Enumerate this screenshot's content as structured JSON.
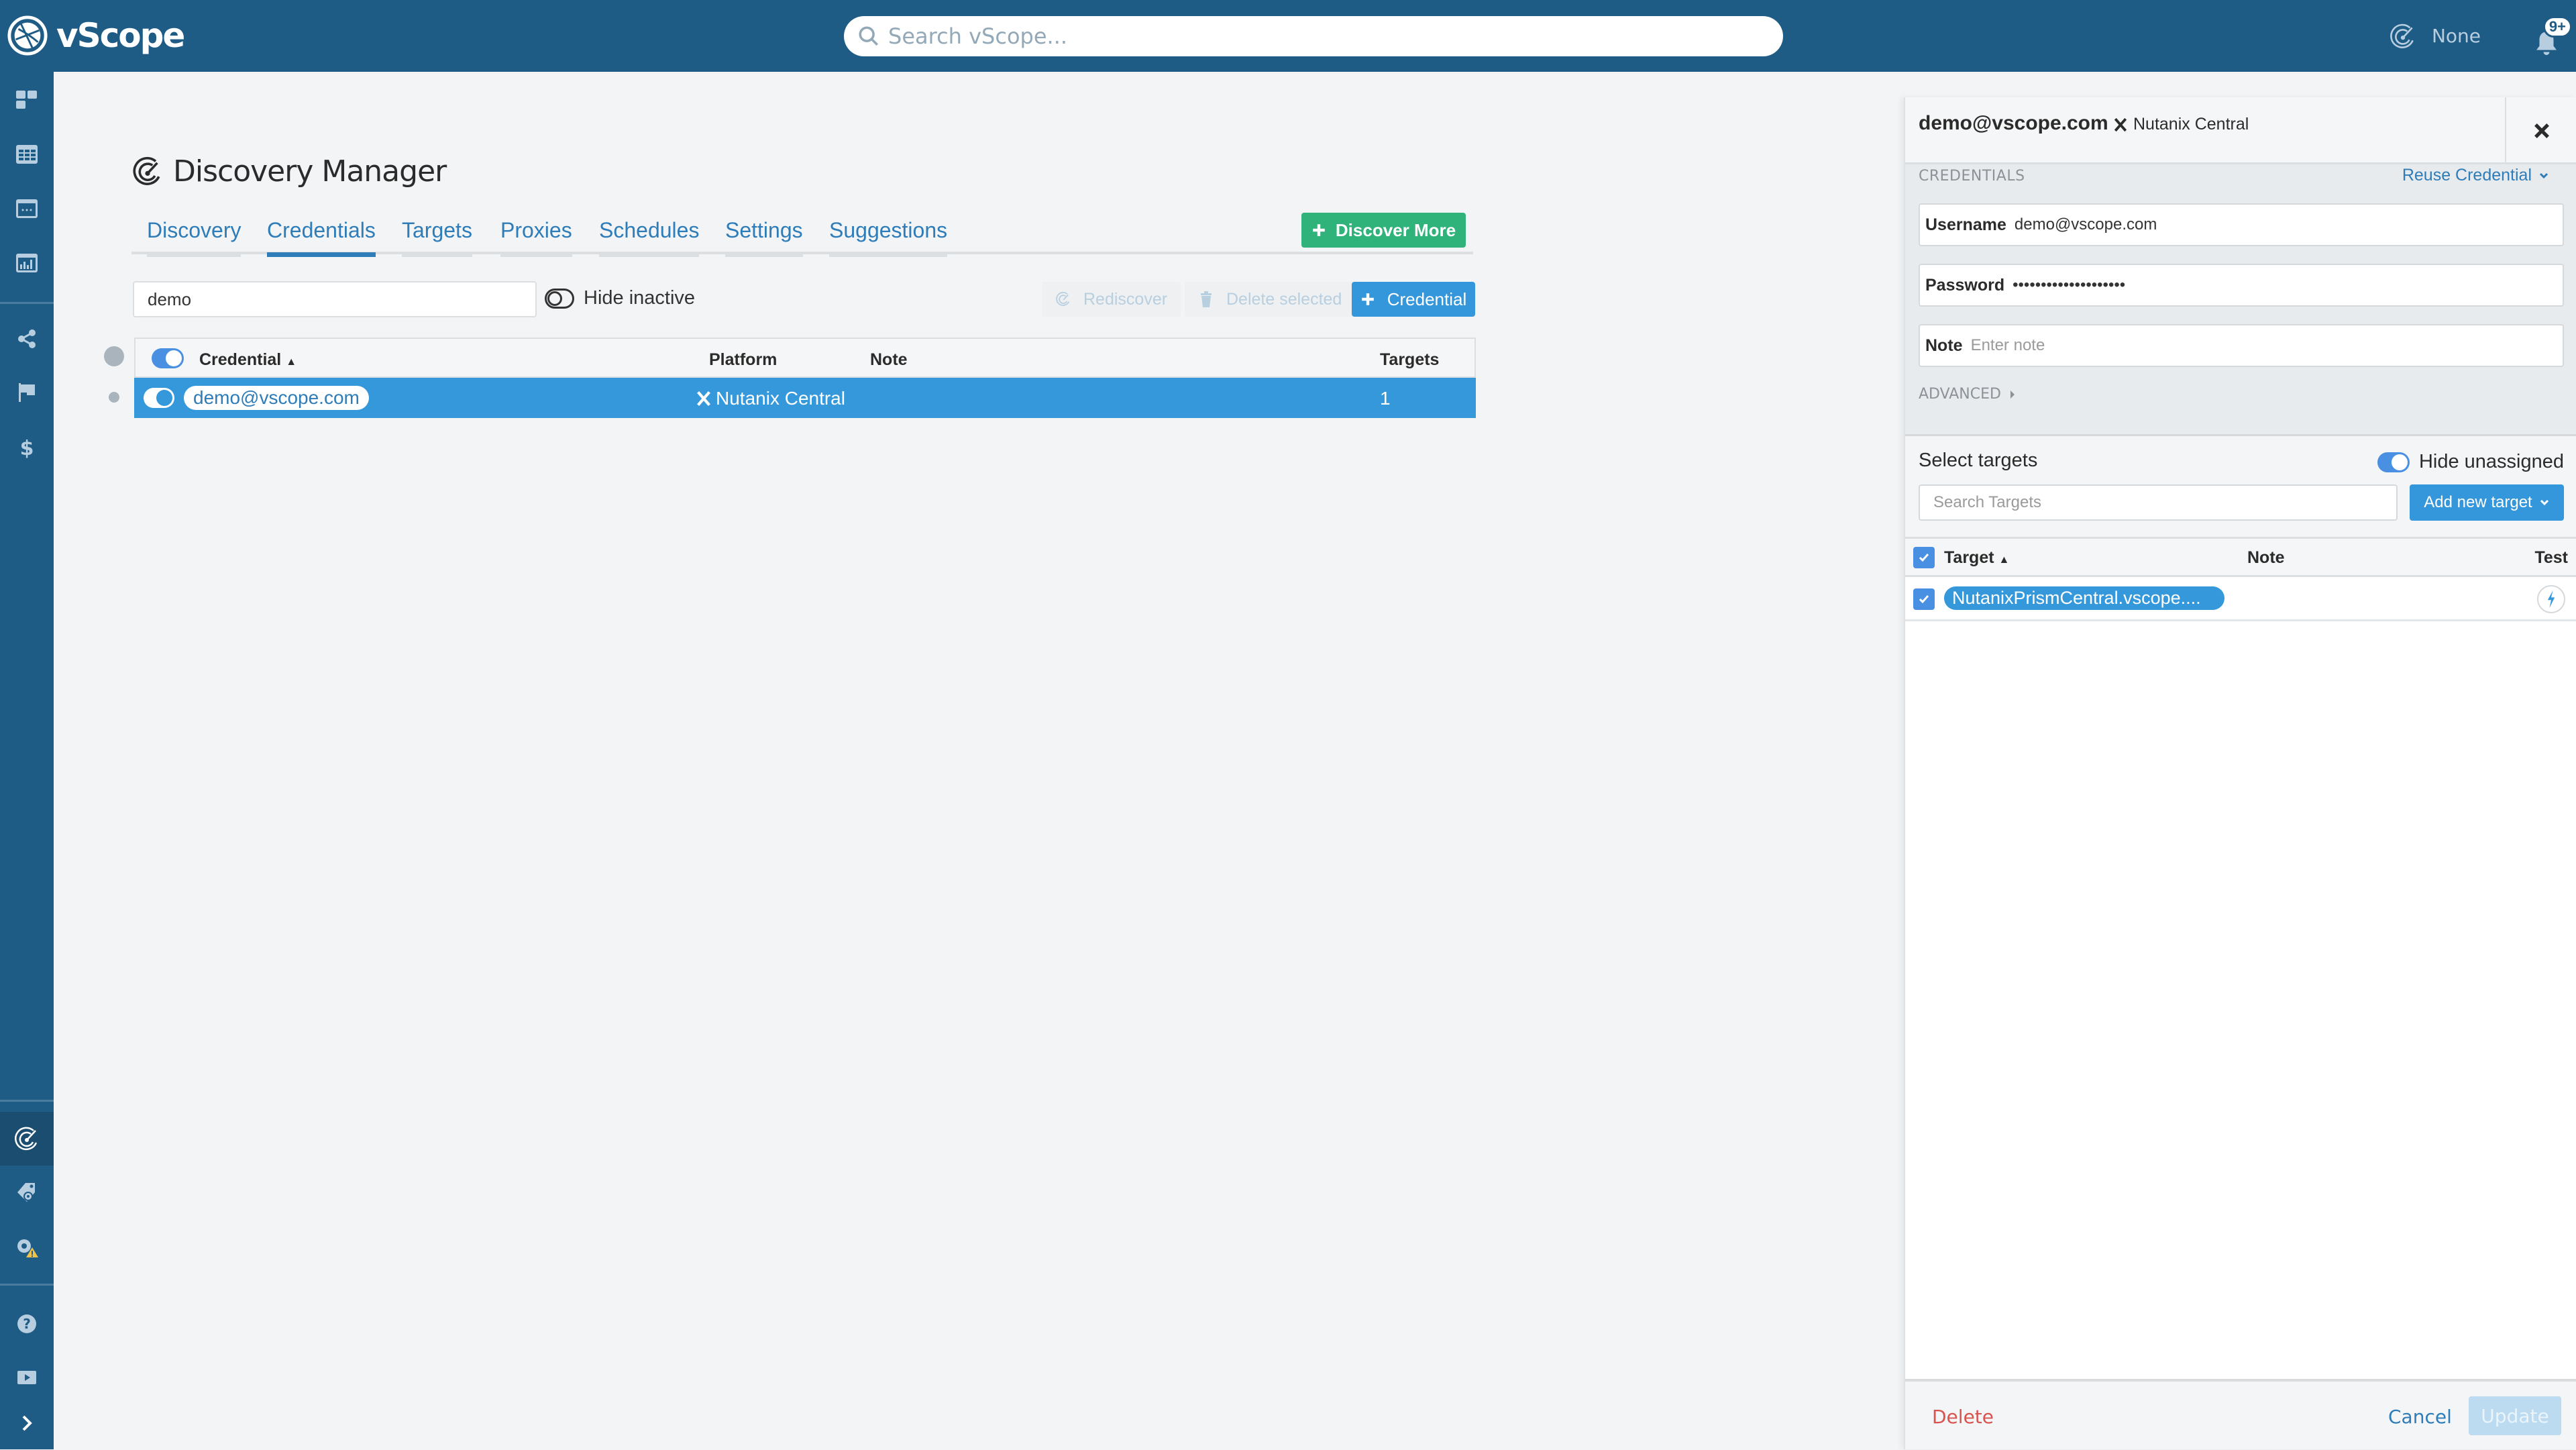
{
  "app": {
    "name": "vScope",
    "search_placeholder": "Search vScope...",
    "scope_label": "None",
    "notifications_badge": "9+"
  },
  "sidebar": {
    "items": [
      {
        "name": "dashboards",
        "icon": "dashboard-tiles-icon"
      },
      {
        "name": "tables",
        "icon": "table-icon"
      },
      {
        "name": "apps",
        "icon": "window-dots-icon"
      },
      {
        "name": "reports",
        "icon": "bar-chart-window-icon"
      },
      {
        "name": "share",
        "icon": "share-icon"
      },
      {
        "name": "flags",
        "icon": "flag-icon"
      },
      {
        "name": "cost",
        "icon": "dollar-icon"
      },
      {
        "name": "discovery",
        "icon": "radar-icon",
        "active": true
      },
      {
        "name": "tag-settings",
        "icon": "tag-gear-icon"
      },
      {
        "name": "settings-warning",
        "icon": "gear-warning-icon"
      },
      {
        "name": "help",
        "icon": "question-icon"
      },
      {
        "name": "video",
        "icon": "play-icon"
      },
      {
        "name": "expand",
        "icon": "chevron-right-icon"
      }
    ]
  },
  "page": {
    "title": "Discovery Manager",
    "tabs": [
      {
        "label": "Discovery",
        "active": false
      },
      {
        "label": "Credentials",
        "active": true
      },
      {
        "label": "Targets",
        "active": false
      },
      {
        "label": "Proxies",
        "active": false
      },
      {
        "label": "Schedules",
        "active": false
      },
      {
        "label": "Settings",
        "active": false
      },
      {
        "label": "Suggestions",
        "active": false
      }
    ],
    "discover_more_label": "Discover More"
  },
  "toolbar": {
    "filter_value": "demo",
    "hide_inactive_label": "Hide inactive",
    "hide_inactive_on": false,
    "rediscover_label": "Rediscover",
    "delete_selected_label": "Delete selected",
    "add_credential_label": "Credential"
  },
  "credentials_table": {
    "columns": [
      "Credential",
      "Platform",
      "Note",
      "Targets"
    ],
    "sort_column": "Credential",
    "sort_dir": "asc",
    "rows": [
      {
        "credential": "demo@vscope.com",
        "platform": "Nutanix Central",
        "note": "",
        "targets": "1",
        "active": true,
        "selected": true
      }
    ]
  },
  "detail_panel": {
    "title": "demo@vscope.com",
    "platform": "Nutanix Central",
    "credentials_section": "CREDENTIALS",
    "reuse_credential_label": "Reuse Credential",
    "username_label": "Username",
    "username_value": "demo@vscope.com",
    "password_label": "Password",
    "password_value": "••••••••••••••••••••",
    "note_label": "Note",
    "note_placeholder": "Enter note",
    "advanced_label": "ADVANCED",
    "select_targets_label": "Select targets",
    "hide_unassigned_label": "Hide unassigned",
    "hide_unassigned_on": true,
    "search_targets_placeholder": "Search Targets",
    "add_new_target_label": "Add new target",
    "targets_columns": [
      "Target",
      "Note",
      "Test"
    ],
    "targets": [
      {
        "name": "NutanixPrismCentral.vscope....",
        "note": "",
        "checked": true
      }
    ],
    "delete_label": "Delete",
    "cancel_label": "Cancel",
    "update_label": "Update"
  },
  "colors": {
    "brand": "#1f5c85",
    "accent": "#3498db",
    "success": "#2fb37a",
    "danger": "#d9534f"
  }
}
